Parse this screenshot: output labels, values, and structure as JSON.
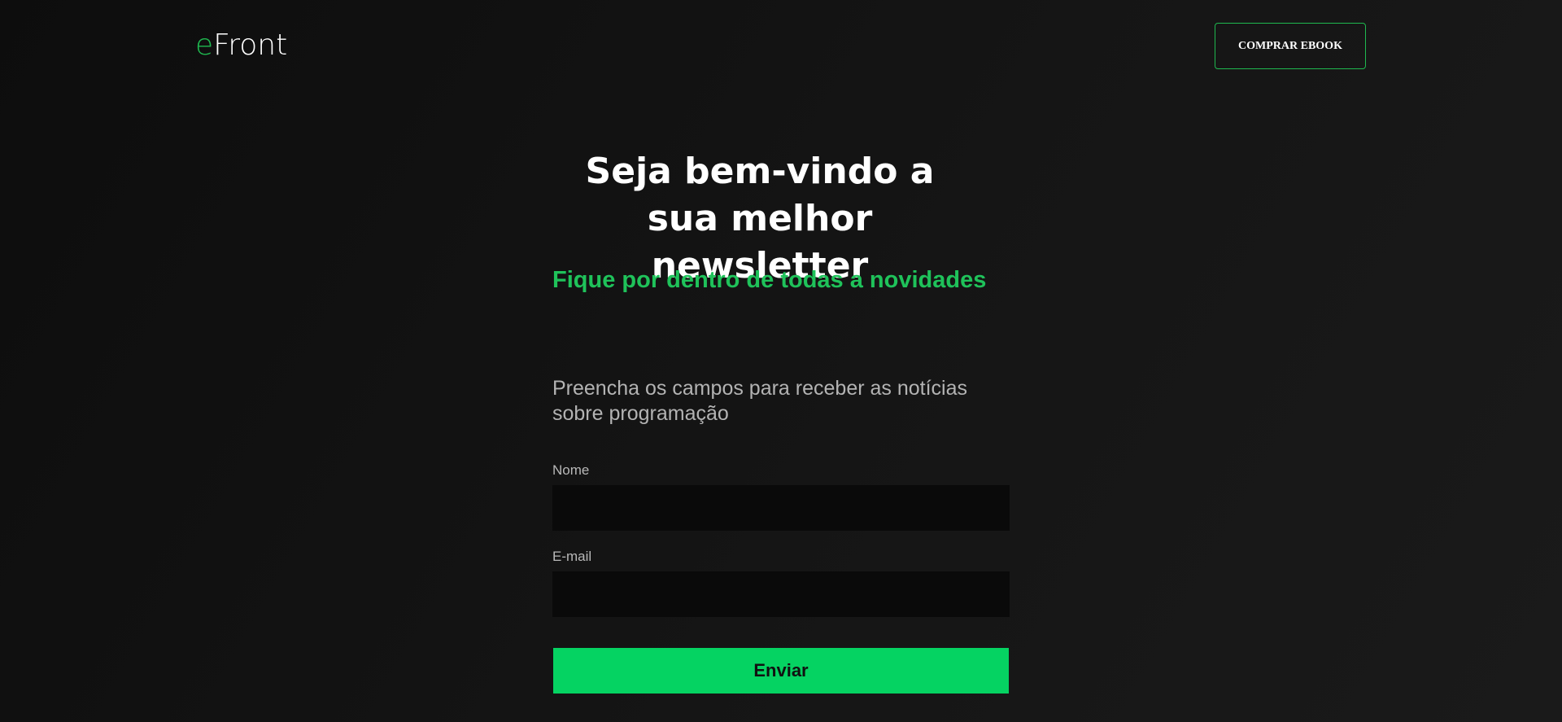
{
  "header": {
    "logo_prefix": "e",
    "logo_rest": "Front",
    "buy_button_label": "COMPRAR EBOOK"
  },
  "hero": {
    "title": "Seja bem-vindo a sua melhor newsletter",
    "subtitle": "Fique por dentro de todas a novidades"
  },
  "form": {
    "instructions": "Preencha os campos para receber as notícias sobre programação",
    "name_label": "Nome",
    "name_value": "",
    "email_label": "E-mail",
    "email_value": "",
    "submit_label": "Enviar"
  },
  "colors": {
    "accent": "#1fc25a",
    "button": "#05d362",
    "background": "#121212"
  }
}
